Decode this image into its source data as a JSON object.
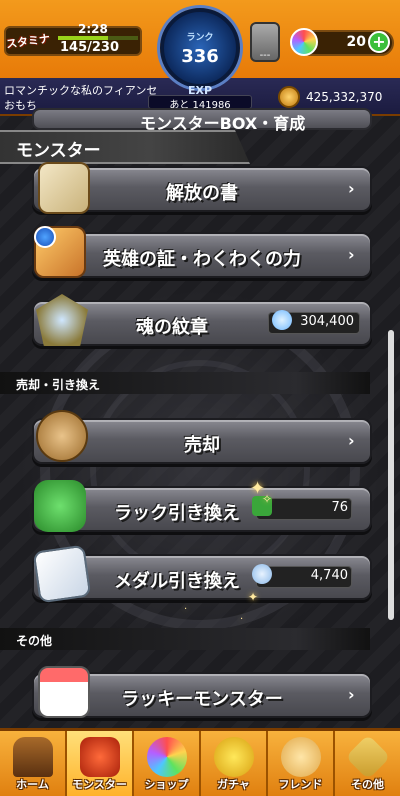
{
  "header": {
    "stamina_label": "スタミナ",
    "stamina_time": "2:28",
    "stamina_value": "145/230",
    "stamina_fraction": 0.63,
    "rank_label": "ランク",
    "rank_value": "336",
    "exp_label": "EXP",
    "exp_remaining": "あと 141986",
    "guild_text": "---",
    "orb_count": "20",
    "orb_plus": "+",
    "player_title": "ロマンチックな私のフィアンセ",
    "player_name": "おもち",
    "coins": "425,332,370"
  },
  "section": {
    "partial_row_label": "モンスターBOX・育成",
    "title": "モンスター"
  },
  "menu": {
    "release_book": "解放の書",
    "hero_proof": "英雄の証・わくわくの力",
    "soul_emblem": "魂の紋章",
    "soul_emblem_count": "304,400",
    "sell_header": "売却・引き換え",
    "sell": "売却",
    "luck_exchange": "ラック引き換え",
    "luck_count": "76",
    "medal_exchange": "メダル引き換え",
    "medal_count": "4,740",
    "other_header": "その他",
    "lucky_monster": "ラッキーモンスター"
  },
  "nav": {
    "items": [
      {
        "label": "ホーム",
        "icon": "home-icon"
      },
      {
        "label": "モンスター",
        "icon": "monster-icon"
      },
      {
        "label": "ショップ",
        "icon": "shop-icon"
      },
      {
        "label": "ガチャ",
        "icon": "gacha-icon"
      },
      {
        "label": "フレンド",
        "icon": "friend-icon"
      },
      {
        "label": "その他",
        "icon": "other-icon"
      }
    ],
    "active_index": 1
  },
  "colors": {
    "header_orange": "#f39a1c",
    "nav_orange": "#f3a52a",
    "row_gray": "#5b5b62"
  }
}
